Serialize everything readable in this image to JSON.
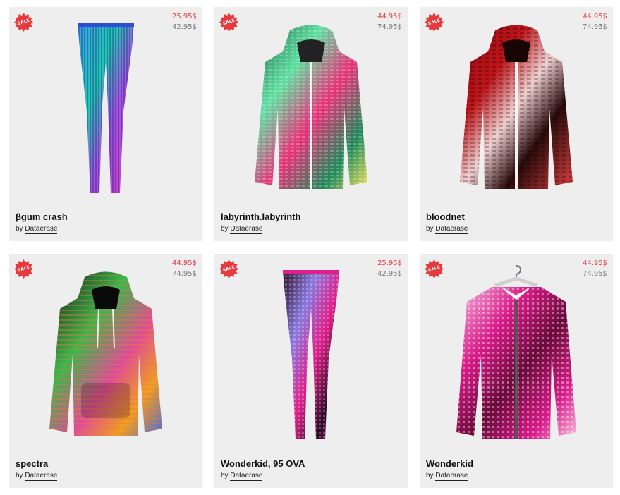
{
  "products": [
    {
      "title": "βgum crash",
      "by": "by",
      "author": "Dataerase",
      "sale_badge": "SALE",
      "price_new": "25.95$",
      "price_old": "42.95$",
      "image_icon": "leggings-icon",
      "palette": [
        "#3aa0e8",
        "#a650e0",
        "#1fc7b0",
        "#d33cc0",
        "#2f4bd8"
      ]
    },
    {
      "title": "labyrinth.labyrinth",
      "by": "by",
      "author": "Dataerase",
      "sale_badge": "SALE",
      "price_new": "44.95$",
      "price_old": "74.95$",
      "image_icon": "zip-hoodie-icon",
      "palette": [
        "#1e8a5a",
        "#e8337a",
        "#5ee0a0",
        "#f4e05a",
        "#1a5a48"
      ]
    },
    {
      "title": "bloodnet",
      "by": "by",
      "author": "Dataerase",
      "sale_badge": "SALE",
      "price_new": "44.95$",
      "price_old": "74.95$",
      "image_icon": "zip-hoodie-icon",
      "palette": [
        "#c0141a",
        "#2a0a0a",
        "#f0d0d0",
        "#8a0a10",
        "#e04040"
      ]
    },
    {
      "title": "spectra",
      "by": "by",
      "author": "Dataerase",
      "sale_badge": "SALE",
      "price_new": "44.95$",
      "price_old": "74.95$",
      "image_icon": "pullover-hoodie-icon",
      "palette": [
        "#111111",
        "#3ab84a",
        "#e04a9a",
        "#f0a020",
        "#4a6ae0"
      ]
    },
    {
      "title": "Wonderkid, 95 OVA",
      "by": "by",
      "author": "Dataerase",
      "sale_badge": "SALE",
      "price_new": "25.95$",
      "price_old": "42.95$",
      "image_icon": "leggings-icon",
      "palette": [
        "#e0208a",
        "#2a0a24",
        "#8a7ae0",
        "#f0e040",
        "#ffffff"
      ]
    },
    {
      "title": "Wonderkid",
      "by": "by",
      "author": "Dataerase",
      "sale_badge": "SALE",
      "price_new": "44.95$",
      "price_old": "74.95$",
      "image_icon": "bomber-jacket-icon",
      "palette": [
        "#d81c8a",
        "#6a0a3a",
        "#f6c0e0",
        "#ffffff",
        "#a01060"
      ]
    }
  ]
}
